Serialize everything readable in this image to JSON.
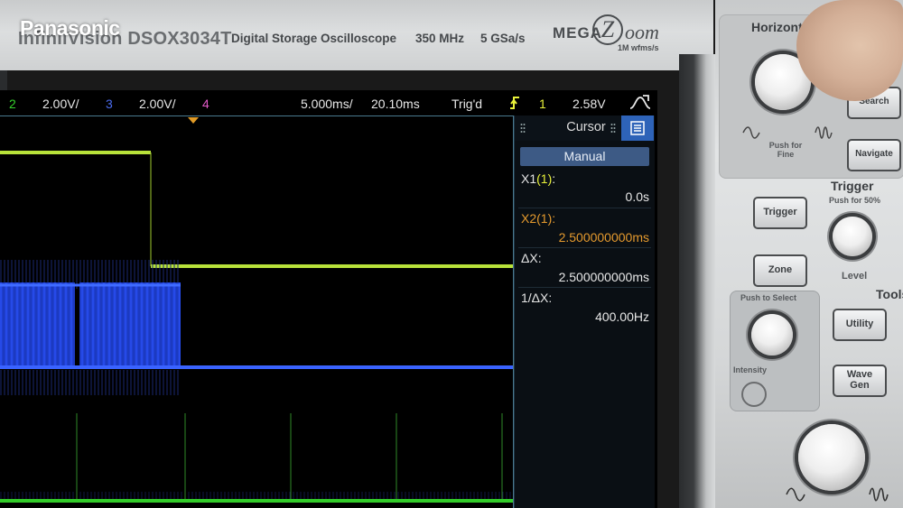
{
  "brand": {
    "logo": "Panasonic",
    "model": "InfiniiVision DSOX3034T",
    "description": "Digital Storage Oscilloscope",
    "bandwidth": "350 MHz",
    "sample_rate": "5 GSa/s",
    "megazoom": {
      "mega": "MEGA",
      "z": "Z",
      "oom": "oom",
      "sub": "1M wfms/s"
    }
  },
  "status": {
    "ch2_num": "2",
    "ch2_scale": "2.00V/",
    "ch3_num": "3",
    "ch3_scale": "2.00V/",
    "ch4_num": "4",
    "time_scale": "5.000ms/",
    "time_delay": "20.10ms",
    "trigger_state": "Trig'd",
    "trigger_source": "1",
    "trigger_level": "2.58V"
  },
  "cursor_panel": {
    "title": "Cursor",
    "mode": "Manual",
    "x1_label": "X1",
    "x1_src": "(1)",
    "x1_suffix": ":",
    "x1_value": "0.0s",
    "x2_label": "X2",
    "x2_src": "(1)",
    "x2_suffix": ":",
    "x2_value": "2.500000000ms",
    "dx_label": "ΔX:",
    "dx_value": "2.500000000ms",
    "inv_dx_label": "1/ΔX:",
    "inv_dx_value": "400.00Hz"
  },
  "front_panel": {
    "horizontal": "Horizontal",
    "push_for_fine": "Push for Fine",
    "search": "Search",
    "navigate": "Navigate",
    "trigger_section": "Trigger",
    "push_for_50": "Push for 50%",
    "trigger_btn": "Trigger",
    "zone_btn": "Zone",
    "level": "Level",
    "tools": "Tools",
    "push_to_select": "Push to Select",
    "utility": "Utility",
    "wave_gen_1": "Wave",
    "wave_gen_2": "Gen",
    "intensity": "Intensity"
  },
  "colors": {
    "ch1": "#e9f23a",
    "ch2": "#35d12c",
    "ch3": "#4b6cf0",
    "ch4": "#e25ac8",
    "cursor_x2": "#e59a2e",
    "panel_accent": "#2e63b8"
  }
}
